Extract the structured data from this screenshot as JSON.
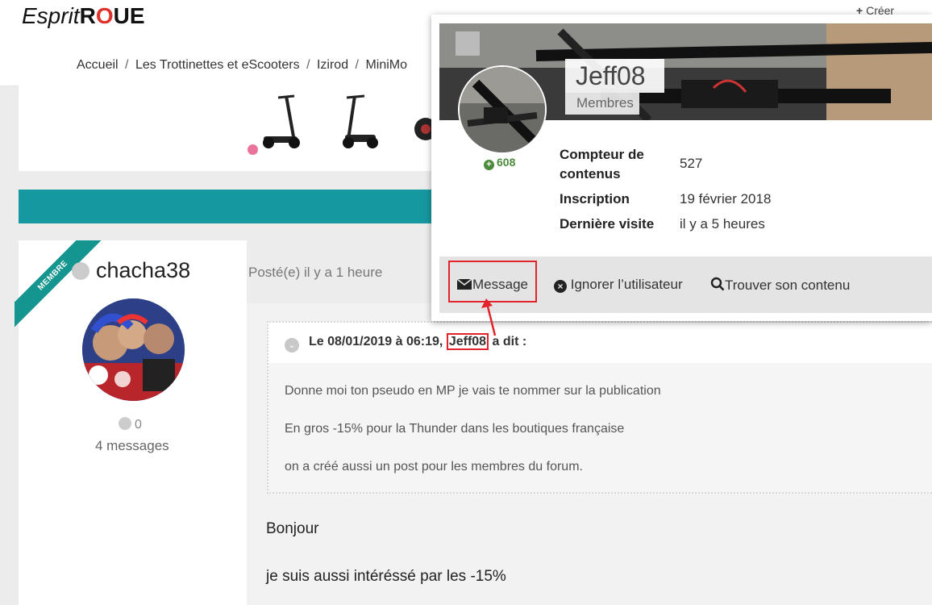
{
  "header": {
    "logo_part1": "Esprit",
    "logo_part2_r": "R",
    "logo_part2_o": "O",
    "logo_part2_ue": "UE",
    "create_label": "Créer",
    "breadcrumb": [
      "Accueil",
      "Les Trottinettes et eScooters",
      "Izirod",
      "MiniMo"
    ],
    "breadcrumb_sep": "/"
  },
  "post": {
    "author": {
      "badge": "MEMBRE",
      "username": "chacha38",
      "reputation": "0",
      "messages": "4 messages"
    },
    "posted": "Posté(e) il y a 1 heure",
    "quote": {
      "header_prefix": "Le 08/01/2019 à 06:19,",
      "author": "Jeff08",
      "header_suffix": "a dit :",
      "lines": [
        "Donne moi ton pseudo en MP je vais te nommer sur la publication",
        "En gros -15% pour la Thunder dans les boutiques française",
        "on a créé aussi un post pour les membres du forum."
      ]
    },
    "body_lines": [
      "Bonjour",
      "je suis aussi intéréssé par les -15%"
    ]
  },
  "hovercard": {
    "name": "Jeff08",
    "group": "Membres",
    "reputation": "608",
    "stats": [
      {
        "label_line1": "Compteur de",
        "label_line2": "contenus",
        "value": "527"
      },
      {
        "label_line1": "Inscription",
        "label_line2": "",
        "value": "19 février 2018"
      },
      {
        "label_line1": "Dernière visite",
        "label_line2": "",
        "value": "il y a 5 heures"
      }
    ],
    "actions": {
      "message": "Message",
      "ignore": "Ignorer l’utilisateur",
      "find": "Trouver son contenu"
    }
  },
  "colors": {
    "accent": "#1698a0",
    "highlight": "#e0242a",
    "logo_red": "#e0312b",
    "rep_green": "#4c8a3c"
  },
  "icons": [
    "envelope-icon",
    "times-circle-icon",
    "search-icon",
    "plus-circle-icon",
    "chevron-down-icon",
    "plus-icon"
  ]
}
